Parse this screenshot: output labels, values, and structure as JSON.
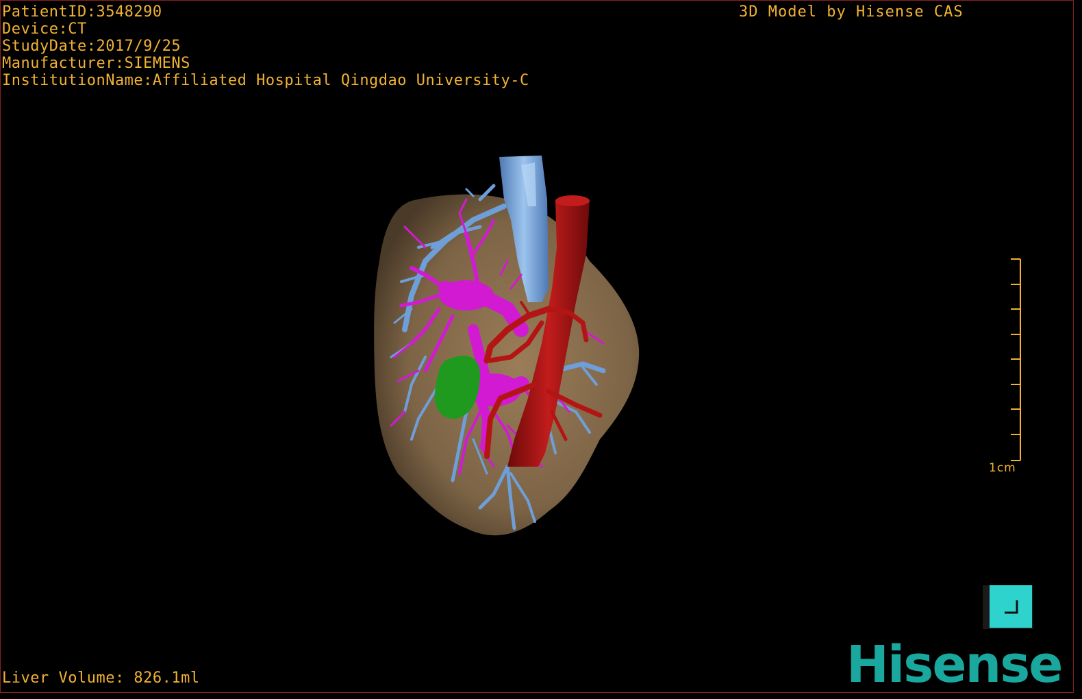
{
  "overlay": {
    "patient_id": "PatientID:3548290",
    "device": "Device:CT",
    "study_date": "StudyDate:2017/9/25",
    "manufacturer": "Manufacturer:SIEMENS",
    "institution": "InstitutionName:Affiliated Hospital Qingdao University-C",
    "credit": "3D Model by Hisense CAS",
    "liver_volume": "Liver Volume: 826.1ml"
  },
  "scale": {
    "label": "1cm"
  },
  "brand": {
    "logo_text": "Hisense"
  },
  "colors": {
    "overlay_text": "#f2b233",
    "liver": "#8b7150",
    "portal_vein": "#d21ad2",
    "hepatic_vein": "#6e9fd8",
    "artery": "#b31515",
    "gallbladder": "#1f9a1f",
    "brand": "#1aa79d",
    "reset_button": "#2ed3cd"
  },
  "icons": {
    "reset_view": "reset-view-icon"
  }
}
